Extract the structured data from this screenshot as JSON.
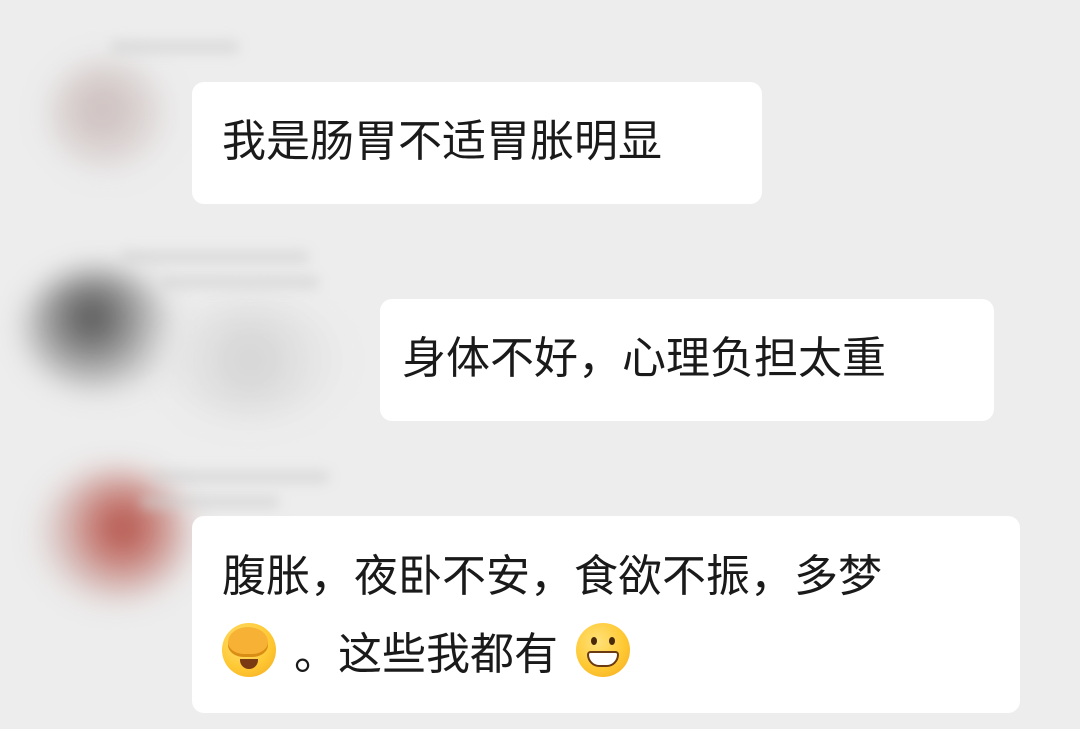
{
  "messages": [
    {
      "text": "我是肠胃不适胃胀明显"
    },
    {
      "text": "身体不好，心理负担太重"
    },
    {
      "line1": "腹胀，夜卧不安，食欲不振，多梦",
      "line2": "。这些我都有",
      "emoji_before": "facepalm-crying-emoji",
      "emoji_after": "grinning-teeth-emoji"
    }
  ],
  "colors": {
    "background": "#ededed",
    "bubble": "#ffffff",
    "text": "#1a1a1a"
  }
}
